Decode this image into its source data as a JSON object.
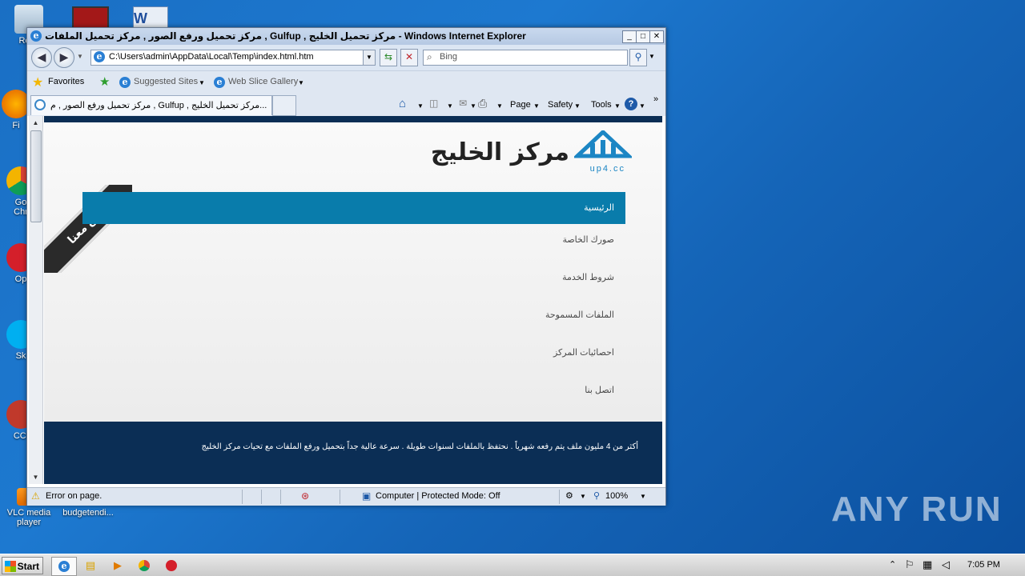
{
  "desktop": {
    "icons": [
      {
        "label": "Recy"
      },
      {
        "label": "Fi"
      },
      {
        "label": "Go\nChr"
      },
      {
        "label": "Op"
      },
      {
        "label": "Sk"
      },
      {
        "label": "CCl"
      },
      {
        "label": "VLC media player"
      },
      {
        "label": "budgetendi..."
      }
    ]
  },
  "window": {
    "title": "مركز تحميل ورفع الصور , مركز تحميل الملفات , Gulfup , مركز تحميل الخليج - Windows Internet Explorer",
    "address": "C:\\Users\\admin\\AppData\\Local\\Temp\\index.html.htm",
    "search_placeholder": "Bing",
    "favorites_label": "Favorites",
    "suggested_sites": "Suggested Sites",
    "web_slice": "Web Slice Gallery",
    "tab_title": "مركز تحميل ورفع الصور , م , Gulfup , مركز تحميل الخليج...",
    "commands": {
      "page": "Page",
      "safety": "Safety",
      "tools": "Tools"
    },
    "controls": {
      "minimize": "_",
      "maximize": "□",
      "close": "✕"
    }
  },
  "page": {
    "logo_text": "مركز الخليج",
    "logo_sub": "up4.cc",
    "ribbon_text": "اعلن معنا",
    "menu": {
      "active": "الرئيسية",
      "items": [
        "صورك الخاصة",
        "شروط الخدمة",
        "الملفات المسموحة",
        "احصائيات المركز",
        "اتصل بنا"
      ]
    },
    "footer_text": "أكثر من 4 مليون ملف يتم رفعه شهرياً . نحتفظ بالملفات لسنوات طويلة . سرعة عالية جداً بتحميل ورفع الملفات مع تحيات مركز الخليج"
  },
  "status": {
    "error": "Error on page.",
    "zone": "Computer | Protected Mode: Off",
    "zoom": "100%"
  },
  "taskbar": {
    "start": "Start",
    "clock": "7:05 PM"
  },
  "watermark": "ANY RUN"
}
